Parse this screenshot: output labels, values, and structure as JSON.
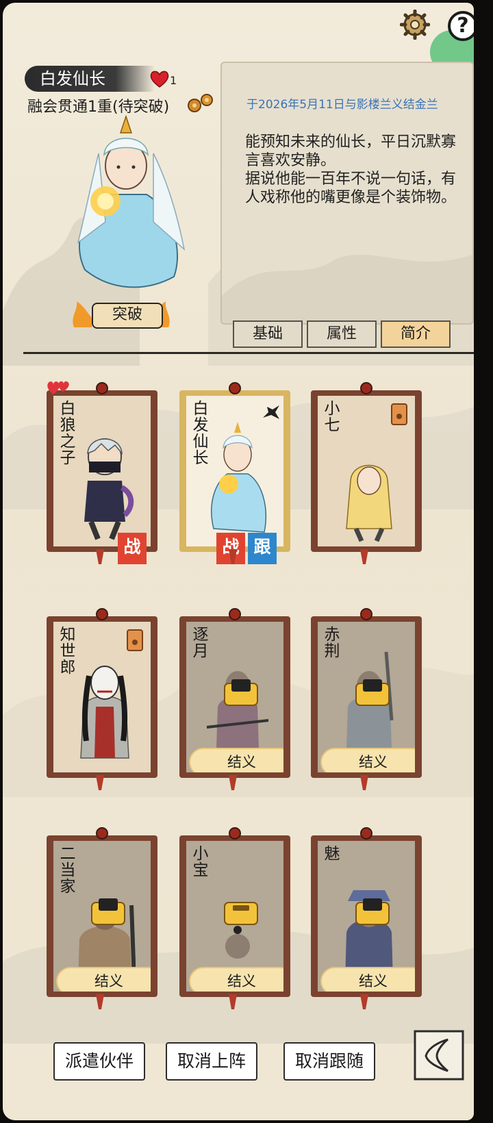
{
  "hero": {
    "name": "白发仙长",
    "affection": "1",
    "realm": "融会贯通1重(待突破)",
    "breakthrough_label": "突破"
  },
  "description": {
    "bond_note": "于2026年5月11日与影楼兰义结金兰",
    "text": "能预知未来的仙长，平日沉默寡言喜欢安静。\n据说他能一百年不说一句话，有人戏称他的嘴更像是个装饰物。"
  },
  "tabs": [
    {
      "label": "基础",
      "active": false
    },
    {
      "label": "属性",
      "active": false
    },
    {
      "label": "简介",
      "active": true
    }
  ],
  "companions": [
    {
      "name": "白狼之子",
      "status": "unlocked",
      "badges": [
        "战"
      ],
      "hearts": true
    },
    {
      "name": "白发仙长",
      "status": "selected",
      "badges": [
        "战",
        "跟"
      ]
    },
    {
      "name": "小七",
      "status": "unlocked",
      "icon": "wood-token-icon"
    },
    {
      "name": "知世郎",
      "status": "unlocked",
      "icon": "wood-token-icon"
    },
    {
      "name": "逐月",
      "status": "locked",
      "action": "结义"
    },
    {
      "name": "赤荆",
      "status": "locked",
      "action": "结义"
    },
    {
      "name": "二当家",
      "status": "locked",
      "action": "结义"
    },
    {
      "name": "小宝",
      "status": "locked",
      "action": "结义"
    },
    {
      "name": "魅",
      "status": "locked",
      "action": "结义"
    }
  ],
  "buttons": {
    "dispatch": "派遣伙伴",
    "cancel_deploy": "取消上阵",
    "cancel_follow": "取消跟随"
  },
  "colors": {
    "badge_battle": "#e04431",
    "badge_follow": "#2d87cc",
    "frame": "#7a4330",
    "frame_selected": "#d8b560",
    "link": "#3b73b5"
  }
}
